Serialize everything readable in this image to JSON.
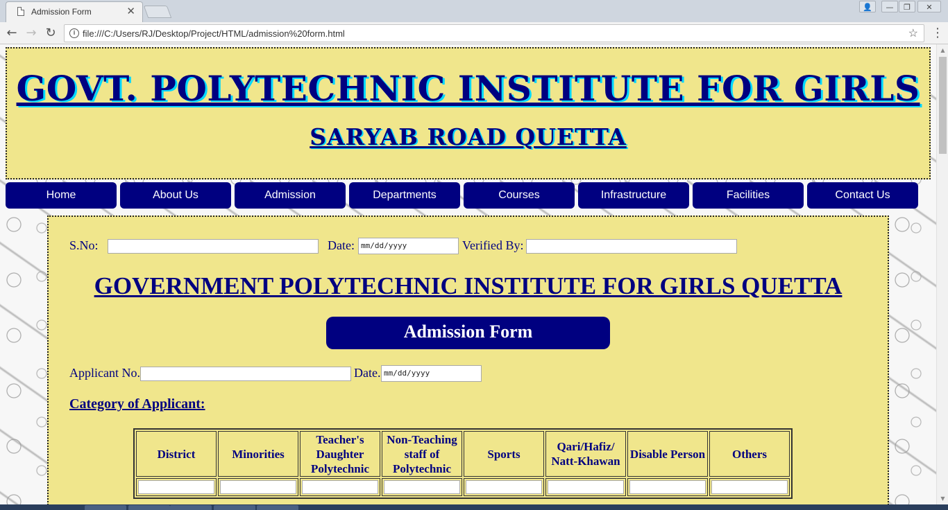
{
  "browser": {
    "tab_title": "Admission Form",
    "tab_close": "✕",
    "url": "file:///C:/Users/RJ/Desktop/Project/HTML/admission%20form.html",
    "info_glyph": "i",
    "star_glyph": "☆",
    "back_glyph": "←",
    "forward_glyph": "→",
    "reload_glyph": "↻",
    "menu_glyph": "⋮",
    "win_user": "👤",
    "win_min": "—",
    "win_restore": "❐",
    "win_close": "✕"
  },
  "header": {
    "title": "GOVT. POLYTECHNIC INSTITUTE FOR GIRLS",
    "subtitle": "SARYAB ROAD QUETTA"
  },
  "nav": {
    "items": [
      "Home",
      "About Us",
      "Admission",
      "Departments",
      "Courses",
      "Infrastructure",
      "Facilities",
      "Contact Us"
    ]
  },
  "form": {
    "sno_label": "S.No:",
    "date_label": "Date:",
    "verified_label": "Verified By:",
    "date_placeholder": "mm/dd/yyyy",
    "institute_title": "GOVERNMENT POLYTECHNIC INSTITUTE FOR GIRLS QUETTA",
    "form_title": "Admission Form",
    "applicant_label": "Applicant No.",
    "applicant_date_label": "Date.",
    "category_heading": "Category of Applicant:",
    "categories": [
      "District",
      "Minorities",
      "Teacher's Daughter Polytechnic",
      "Non-Teaching staff of Polytechnic",
      "Sports",
      "Qari/Hafiz/ Natt-Khawan",
      "Disable Person",
      "Others"
    ]
  },
  "colors": {
    "header_bg": "#f0e68c",
    "accent": "#000080",
    "title_shadow": "#00d8ff"
  }
}
